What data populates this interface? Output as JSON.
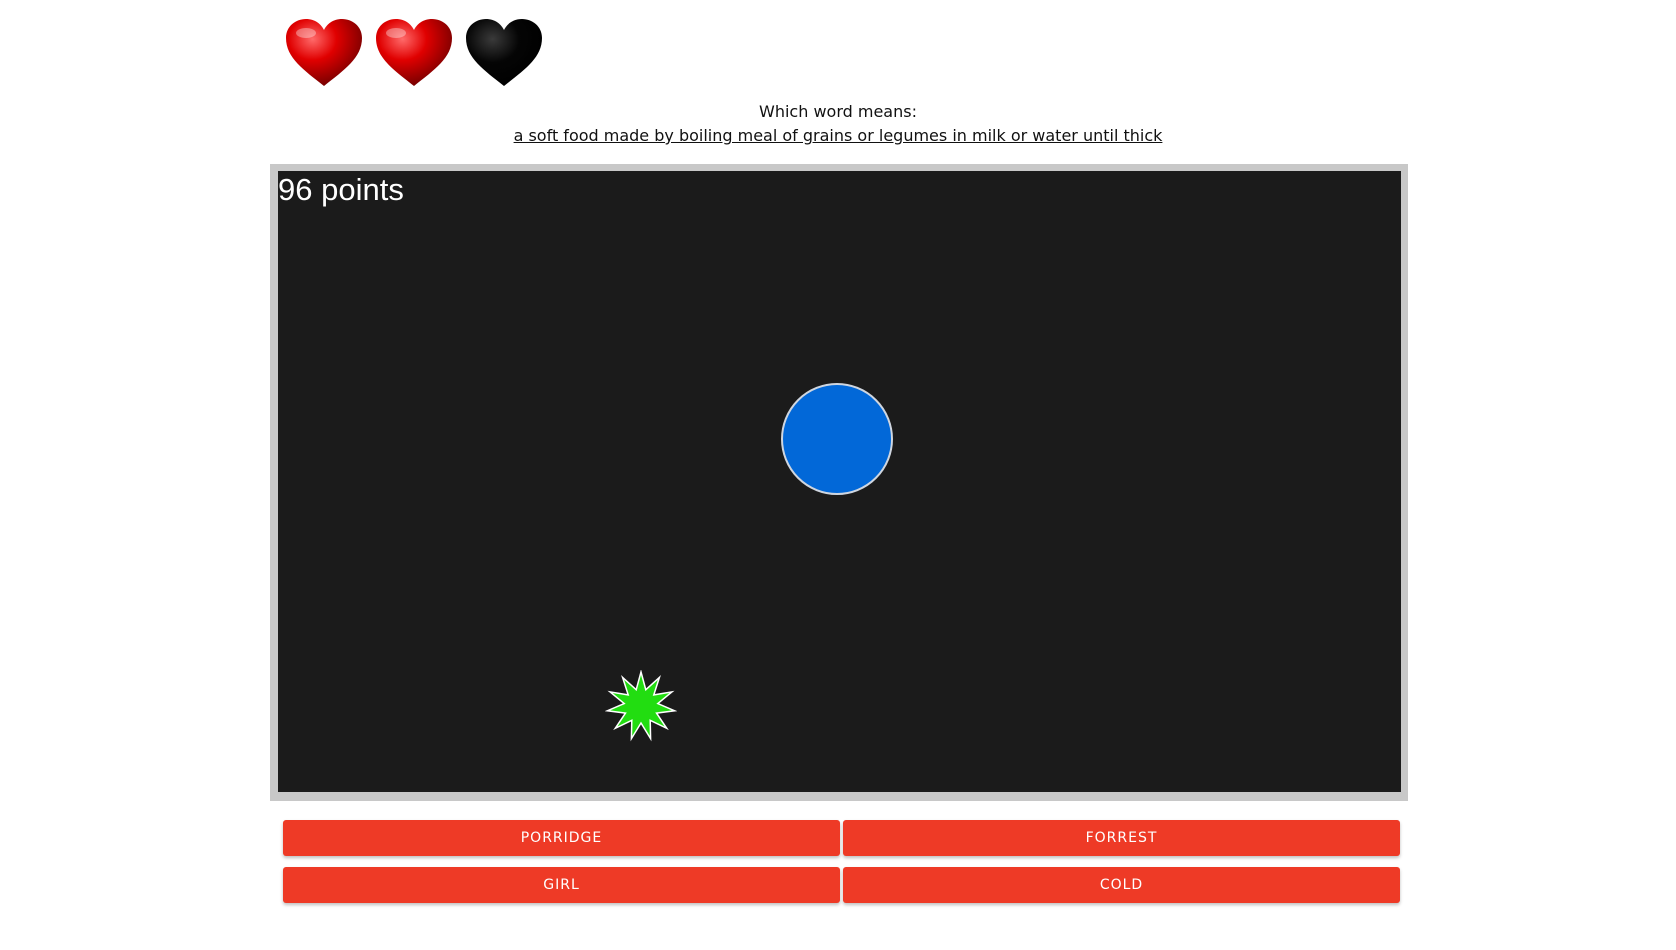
{
  "lives": {
    "hearts": [
      {
        "state": "full",
        "color": "#d90000"
      },
      {
        "state": "full",
        "color": "#d90000"
      },
      {
        "state": "lost",
        "color": "#000000"
      }
    ],
    "remaining": 2,
    "total": 3
  },
  "question": {
    "prompt": "Which word means:",
    "definition": "a soft food made by boiling meal of grains or legumes in milk or water until thick"
  },
  "game": {
    "score_text": "96 points",
    "ball_color": "#0268d8",
    "star_color": "#22dd11",
    "background_color": "#1b1b1b"
  },
  "answers": [
    {
      "label": "PORRIDGE"
    },
    {
      "label": "FORREST"
    },
    {
      "label": "GIRL"
    },
    {
      "label": "COLD"
    }
  ],
  "colors": {
    "button": "#ee3a26",
    "frame": "#c8c8c8"
  }
}
